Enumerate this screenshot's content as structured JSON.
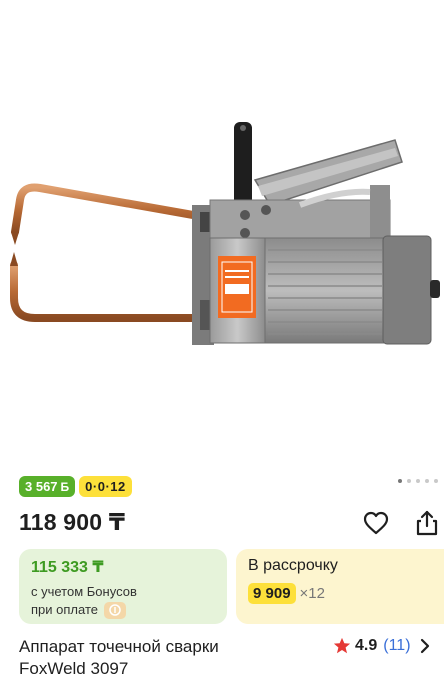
{
  "product": {
    "badge_bonus_value": "3 567",
    "badge_bonus_unit": "Б",
    "badge_installment": "0·0·12",
    "price": "118 900 ₸",
    "title_line1": "Аппарат точечной сварки",
    "title_line2": "FoxWeld 3097",
    "rating": "4.9",
    "review_count": "(11)"
  },
  "bonus_card": {
    "price": "115 333 ₸",
    "line1": "с учетом Бонусов",
    "line2": "при оплате"
  },
  "installment_card": {
    "title": "В рассрочку",
    "monthly": "9 909",
    "multiplier": "×12"
  },
  "gallery": {
    "total_images": 5,
    "active_index": 0
  },
  "icons": {
    "favorite": "heart-outline-icon",
    "share": "share-icon",
    "rating": "star-icon",
    "more": "chevron-right-icon",
    "payment": "payment-icon"
  },
  "colors": {
    "bonus_green": "#58b02a",
    "installment_yellow": "#fde03a",
    "rating_star": "#e53935",
    "link_blue": "#3a6fd8"
  }
}
